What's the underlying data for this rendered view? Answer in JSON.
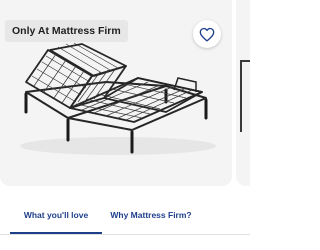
{
  "product": {
    "badge": "Only At Mattress Firm",
    "image_alt": "adjustable bed base",
    "wishlist_icon": "heart-outline-icon"
  },
  "tabs": [
    {
      "label": "What you'll love",
      "active": true
    },
    {
      "label": "Why Mattress Firm?",
      "active": false
    }
  ],
  "colors": {
    "accent": "#1e3f8a",
    "card_background": "#f4f4f4",
    "badge_background": "#e7e7e7",
    "frame": "#262626"
  }
}
